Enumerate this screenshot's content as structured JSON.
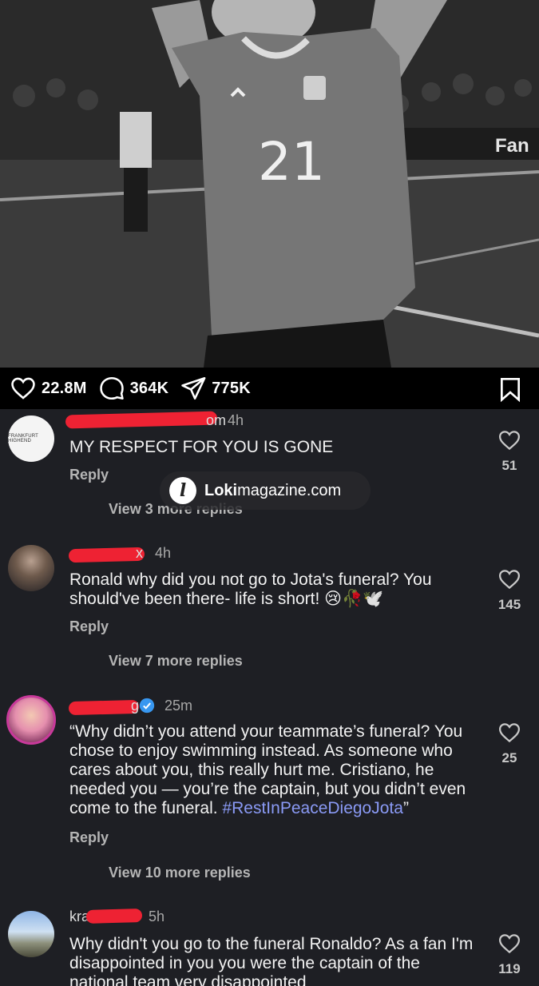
{
  "post": {
    "jersey_number": "21"
  },
  "actions": {
    "likes": "22.8M",
    "comments": "364K",
    "shares": "775K"
  },
  "watermark": {
    "brand": "Loki",
    "domain": "magazine.com"
  },
  "comments": [
    {
      "username_fragment": "om",
      "time": "4h",
      "avatar_text": "FRANKFURT HIGHEND",
      "text": "MY RESPECT FOR YOU IS GONE",
      "reply_label": "Reply",
      "view_replies": "View 3 more replies",
      "like_count": "51"
    },
    {
      "username_fragment": "x",
      "time": "4h",
      "text": "Ronald why did you not go to Jota's funeral? You should've been there- life is short! 😢🥀🕊️",
      "reply_label": "Reply",
      "view_replies": "View 7 more replies",
      "like_count": "145"
    },
    {
      "username_fragment": "g",
      "time": "25m",
      "text_plain": "“Why didn’t you attend your teammate’s funeral? You chose to enjoy swimming instead. As someone who cares about you, this really hurt me. Cristiano, he needed you — you’re the captain, but you didn’t even come to the funeral. ",
      "hashtag": "#RestInPeaceDiegoJota",
      "text_end": "”",
      "reply_label": "Reply",
      "view_replies": "View 10 more replies",
      "like_count": "25"
    },
    {
      "username_fragment": "kra",
      "time": "5h",
      "text": "Why didn't you go to the funeral Ronaldo? As a fan I'm disappointed in you you were the captain of the national team very disappointed",
      "like_count": "119"
    }
  ]
}
